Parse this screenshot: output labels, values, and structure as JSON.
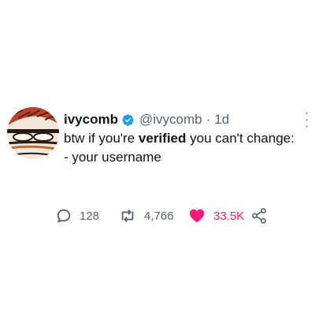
{
  "author": {
    "display_name": "ivycomb",
    "handle": "@ivycomb",
    "separator": "·",
    "time": "1d",
    "verified": true
  },
  "tweet": {
    "text_before": "btw if you're ",
    "text_bold": "verified",
    "text_after": " you can't change:",
    "line2": "- your username"
  },
  "actions": {
    "replies": "128",
    "retweets": "4,766",
    "likes": "33.5K"
  },
  "colors": {
    "verified_badge": "#1d9bf0",
    "like": "#f91880",
    "secondary_text": "#536471",
    "primary_text": "#0f1419"
  },
  "icons": {
    "verified": "verified-badge-icon",
    "reply": "reply-icon",
    "retweet": "retweet-icon",
    "like": "heart-icon",
    "share": "share-icon",
    "more": "more-options-icon"
  }
}
